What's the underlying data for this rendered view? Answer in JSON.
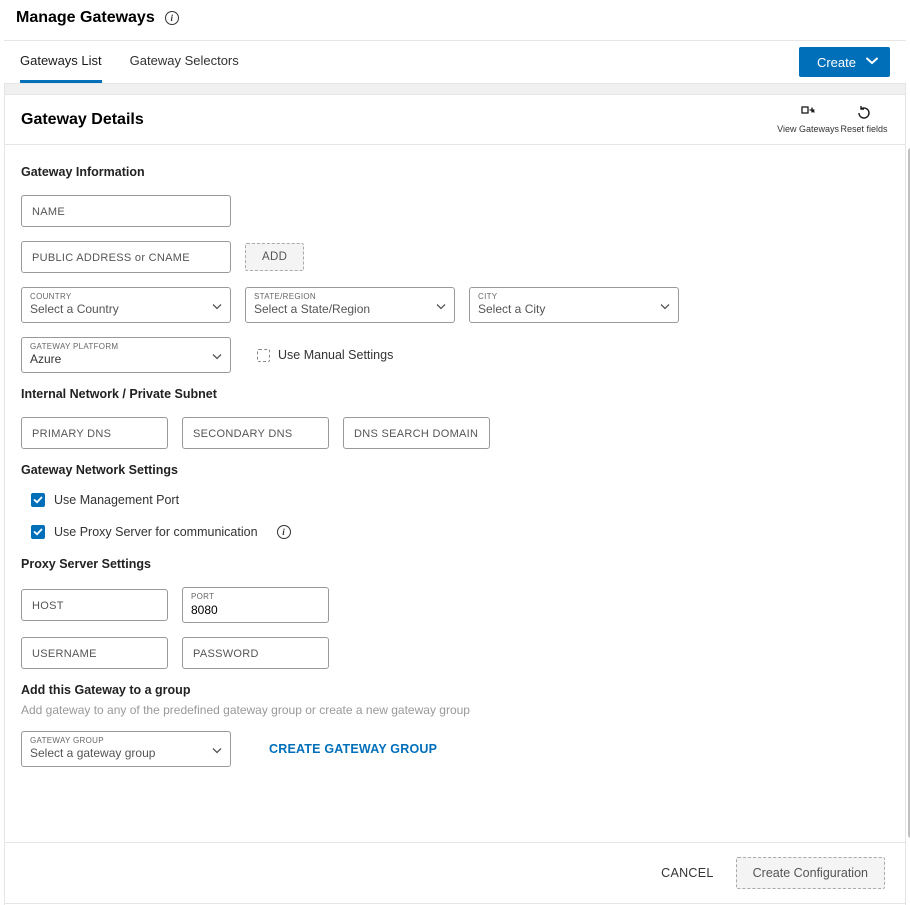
{
  "header": {
    "title": "Manage Gateways"
  },
  "tabs": {
    "list": "Gateways List",
    "selectors": "Gateway Selectors",
    "create_btn": "Create"
  },
  "details": {
    "title": "Gateway Details",
    "actions": {
      "view": "View Gateways",
      "reset": "Reset fields"
    }
  },
  "section": {
    "gateway_info": "Gateway Information",
    "internal_network": "Internal Network / Private Subnet",
    "network_settings": "Gateway Network Settings",
    "proxy_settings": "Proxy Server Settings",
    "add_group": "Add this Gateway to a group",
    "add_group_help": "Add gateway to any of the predefined gateway group or create a new gateway group"
  },
  "fields": {
    "name_ph": "NAME",
    "public_addr_ph": "PUBLIC ADDRESS or CNAME",
    "add_btn": "ADD",
    "country_lbl": "COUNTRY",
    "country_val": "Select a Country",
    "state_lbl": "STATE/REGION",
    "state_val": "Select a State/Region",
    "city_lbl": "CITY",
    "city_val": "Select a City",
    "platform_lbl": "GATEWAY PLATFORM",
    "platform_val": "Azure",
    "manual": "Use Manual Settings",
    "primary_dns_ph": "PRIMARY DNS",
    "secondary_dns_ph": "SECONDARY DNS",
    "dns_search_ph": "DNS SEARCH DOMAIN",
    "use_mgmt": "Use Management Port",
    "use_proxy": "Use Proxy Server for communication",
    "host_ph": "HOST",
    "port_lbl": "PORT",
    "port_val": "8080",
    "username_ph": "USERNAME",
    "password_ph": "PASSWORD",
    "group_lbl": "GATEWAY GROUP",
    "group_val": "Select a gateway group",
    "create_group": "CREATE GATEWAY GROUP"
  },
  "footer": {
    "cancel": "CANCEL",
    "create_config": "Create Configuration"
  }
}
